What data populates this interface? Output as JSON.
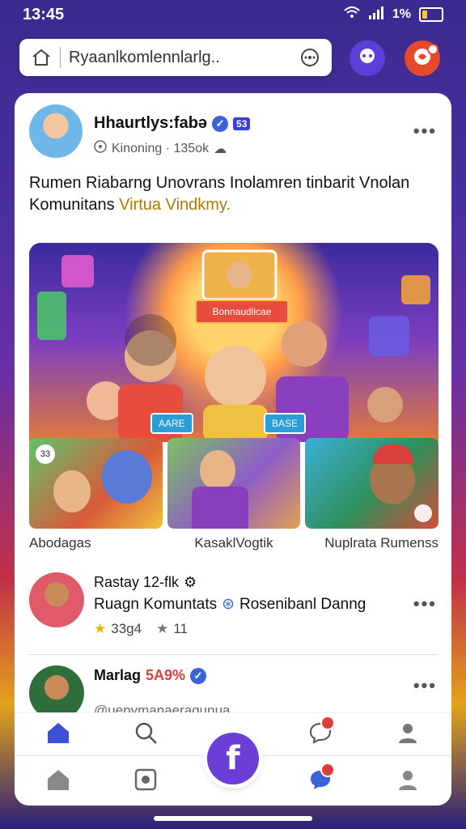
{
  "status_bar": {
    "time": "13:45",
    "battery": "1%"
  },
  "search": {
    "text": "Ryaanlkomlennlarlg.."
  },
  "colors": {
    "accent": "#5b3fd6",
    "notification": "#e54b2a",
    "verified": "#3b63d8"
  },
  "post": {
    "author": "Hhaurtlys:fabǝ",
    "tag": "53",
    "meta": "Kinoning · 135ok",
    "text_main": "Rumen Riabarng Unovrans Inolamren tinbarit Vnolan Komunitans ",
    "text_highlight": "Virtua Vindkmy.",
    "hero_banner": "Bonnaudlicae",
    "hero_label_left": "AARE",
    "hero_label_right": "BASE",
    "thumb_badge": "33",
    "thumbnails": [
      "Abodagas",
      "KasaklVogtik",
      "Nuplrata Rumenss"
    ]
  },
  "comments": [
    {
      "name": "Rastay 12-flk",
      "text": "Ruagn Komuntats",
      "mention": "Rosenibanl Danng",
      "likes": "33g4",
      "shares": "11"
    },
    {
      "name": "Marlag",
      "name_badge": "5A9%",
      "sub": "@uepymanaeragunua"
    }
  ],
  "icons": {
    "search_home": "home-icon",
    "search_camera": "camera-icon",
    "msg": "message-icon",
    "notif": "notification-icon",
    "nav_home": "home-icon",
    "nav_search": "search-icon",
    "nav_comment": "comment-icon",
    "nav_profile": "profile-icon",
    "fab": "f"
  }
}
